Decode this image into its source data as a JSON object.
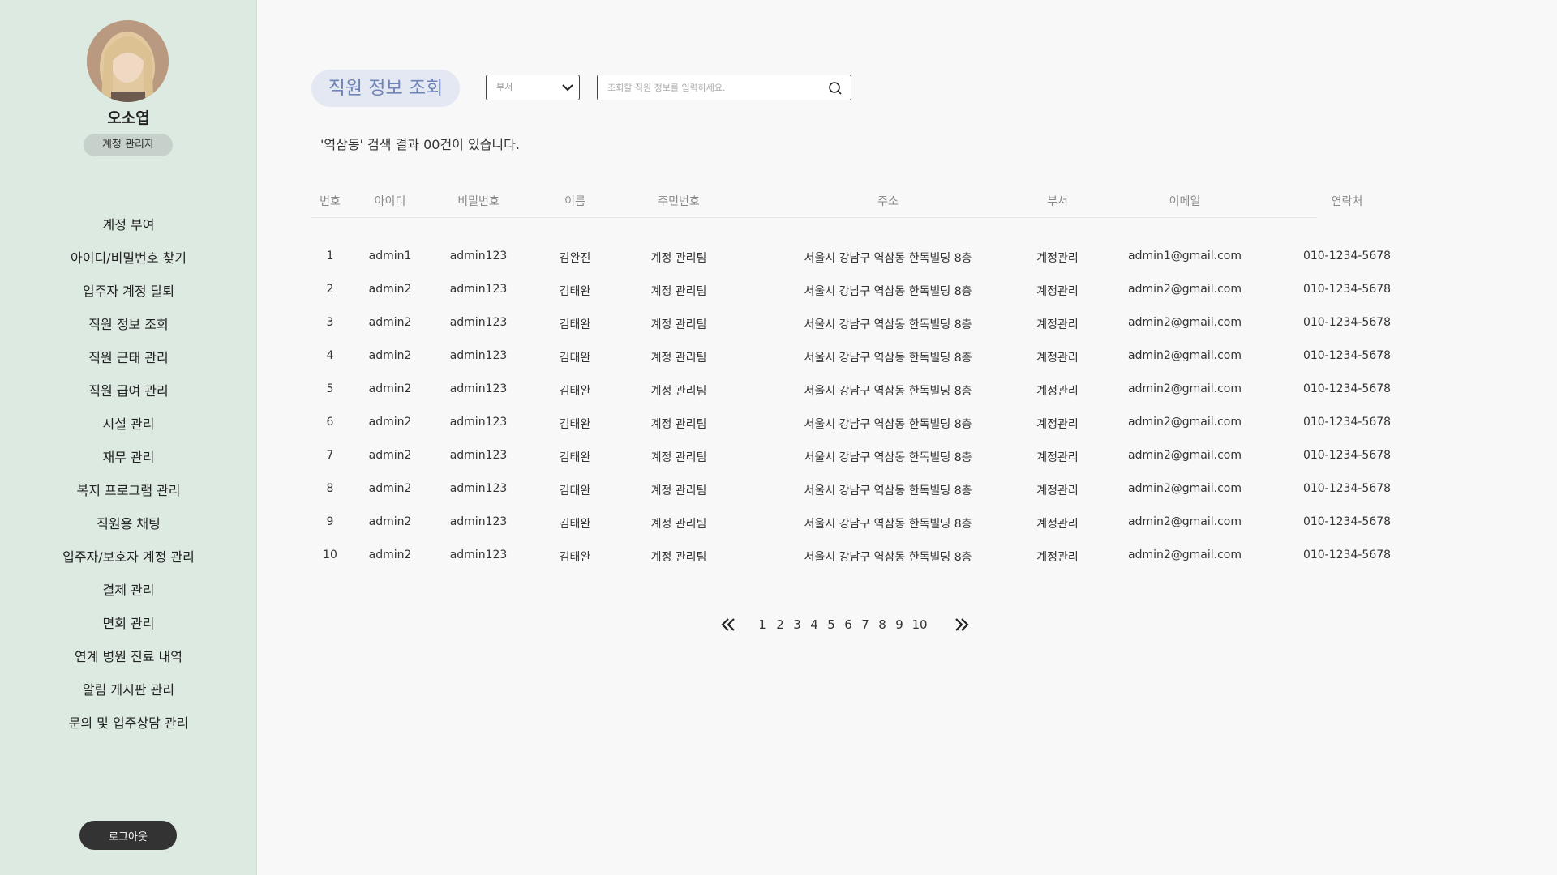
{
  "sidebar": {
    "user_name": "오소엽",
    "role": "계정 관리자",
    "items": [
      {
        "label": "계정 부여"
      },
      {
        "label": "아이디/비밀번호 찾기"
      },
      {
        "label": "입주자 계정 탈퇴"
      },
      {
        "label": "직원 정보 조회"
      },
      {
        "label": "직원 근태 관리"
      },
      {
        "label": "직원 급여 관리"
      },
      {
        "label": "시설 관리"
      },
      {
        "label": "재무 관리"
      },
      {
        "label": "복지 프로그램 관리"
      },
      {
        "label": "직원용 채팅"
      },
      {
        "label": "입주자/보호자 계정 관리"
      },
      {
        "label": "결제 관리"
      },
      {
        "label": "면회 관리"
      },
      {
        "label": "연계 병원 진료 내역"
      },
      {
        "label": "알림 게시판 관리"
      },
      {
        "label": "문의 및 입주상담 관리"
      }
    ],
    "logout_label": "로그아웃"
  },
  "main": {
    "title": "직원 정보 조회",
    "dept_select": {
      "value": "부서",
      "icon": "chevron-down-icon"
    },
    "search": {
      "placeholder": "조회할 직원 정보를 입력하세요.",
      "value": "",
      "icon": "search-icon"
    },
    "result_text": "'역삼동' 검색 결과 00건이 있습니다."
  },
  "table": {
    "headers": [
      "번호",
      "아이디",
      "비밀번호",
      "이름",
      "주민번호",
      "주소",
      "부서",
      "이메일",
      "연락처"
    ],
    "rows": [
      [
        "1",
        "admin1",
        "admin123",
        "김완진",
        "계정 관리팀",
        "서울시 강남구 역삼동 한독빌딩 8층",
        "계정관리",
        "admin1@gmail.com",
        "010-1234-5678"
      ],
      [
        "2",
        "admin2",
        "admin123",
        "김태완",
        "계정 관리팀",
        "서울시 강남구 역삼동 한독빌딩 8층",
        "계정관리",
        "admin2@gmail.com",
        "010-1234-5678"
      ],
      [
        "3",
        "admin2",
        "admin123",
        "김태완",
        "계정 관리팀",
        "서울시 강남구 역삼동 한독빌딩 8층",
        "계정관리",
        "admin2@gmail.com",
        "010-1234-5678"
      ],
      [
        "4",
        "admin2",
        "admin123",
        "김태완",
        "계정 관리팀",
        "서울시 강남구 역삼동 한독빌딩 8층",
        "계정관리",
        "admin2@gmail.com",
        "010-1234-5678"
      ],
      [
        "5",
        "admin2",
        "admin123",
        "김태완",
        "계정 관리팀",
        "서울시 강남구 역삼동 한독빌딩 8층",
        "계정관리",
        "admin2@gmail.com",
        "010-1234-5678"
      ],
      [
        "6",
        "admin2",
        "admin123",
        "김태완",
        "계정 관리팀",
        "서울시 강남구 역삼동 한독빌딩 8층",
        "계정관리",
        "admin2@gmail.com",
        "010-1234-5678"
      ],
      [
        "7",
        "admin2",
        "admin123",
        "김태완",
        "계정 관리팀",
        "서울시 강남구 역삼동 한독빌딩 8층",
        "계정관리",
        "admin2@gmail.com",
        "010-1234-5678"
      ],
      [
        "8",
        "admin2",
        "admin123",
        "김태완",
        "계정 관리팀",
        "서울시 강남구 역삼동 한독빌딩 8층",
        "계정관리",
        "admin2@gmail.com",
        "010-1234-5678"
      ],
      [
        "9",
        "admin2",
        "admin123",
        "김태완",
        "계정 관리팀",
        "서울시 강남구 역삼동 한독빌딩 8층",
        "계정관리",
        "admin2@gmail.com",
        "010-1234-5678"
      ],
      [
        "10",
        "admin2",
        "admin123",
        "김태완",
        "계정 관리팀",
        "서울시 강남구 역삼동 한독빌딩 8층",
        "계정관리",
        "admin2@gmail.com",
        "010-1234-5678"
      ]
    ]
  },
  "pagination": {
    "pages": [
      "1",
      "2",
      "3",
      "4",
      "5",
      "6",
      "7",
      "8",
      "9",
      "10"
    ],
    "first_icon": "double-chevron-left-icon",
    "last_icon": "double-chevron-right-icon"
  },
  "colors": {
    "sidebar_bg": "#dceae1",
    "title_pill_bg": "#e3e8f3",
    "title_text": "#6f84b8",
    "logout_bg": "#333333"
  }
}
